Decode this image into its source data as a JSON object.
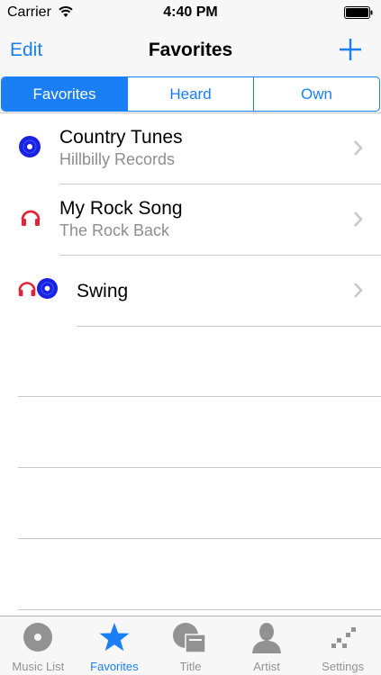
{
  "status_bar": {
    "carrier": "Carrier",
    "time": "4:40 PM"
  },
  "nav": {
    "edit_label": "Edit",
    "title": "Favorites"
  },
  "segments": [
    {
      "label": "Favorites",
      "selected": true
    },
    {
      "label": "Heard",
      "selected": false
    },
    {
      "label": "Own",
      "selected": false
    }
  ],
  "rows": [
    {
      "title": "Country Tunes",
      "subtitle": "Hillbilly Records",
      "icons": [
        "disc-icon"
      ]
    },
    {
      "title": "My Rock Song",
      "subtitle": "The Rock Back",
      "icons": [
        "headphones-icon"
      ]
    },
    {
      "title": "Swing",
      "subtitle": "",
      "icons": [
        "headphones-icon",
        "disc-icon"
      ]
    }
  ],
  "tabs": [
    {
      "label": "Music List",
      "icon": "disc-icon",
      "active": false
    },
    {
      "label": "Favorites",
      "icon": "star-icon",
      "active": true
    },
    {
      "label": "Title",
      "icon": "title-icon",
      "active": false
    },
    {
      "label": "Artist",
      "icon": "person-icon",
      "active": false
    },
    {
      "label": "Settings",
      "icon": "settings-icon",
      "active": false
    }
  ],
  "colors": {
    "accent": "#1a7ef5",
    "disc": "#1a21e0",
    "headphones": "#e0253a",
    "inactive": "#929292"
  }
}
